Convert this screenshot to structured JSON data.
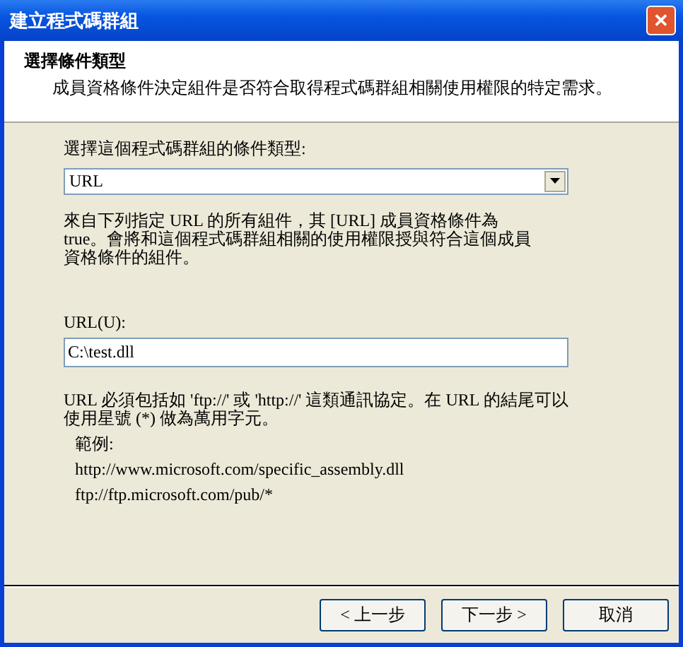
{
  "window": {
    "title": "建立程式碼群組",
    "close": "✕"
  },
  "header": {
    "title": "選擇條件類型",
    "description": "成員資格條件決定組件是否符合取得程式碼群組相關使用權限的特定需求。"
  },
  "condition_type": {
    "label": "選擇這個程式碼群組的條件類型:",
    "value": "URL"
  },
  "condition_description": "來自下列指定 URL 的所有組件，其 [URL] 成員資格條件為 true。會將和這個程式碼群組相關的使用權限授與符合這個成員資格條件的組件。",
  "url": {
    "label": "URL(U):",
    "value": "C:\\test.dll"
  },
  "help": "URL 必須包括如 'ftp://' 或 'http://' 這類通訊協定。在 URL 的結尾可以使用星號 (*) 做為萬用字元。",
  "examples": {
    "label": "範例:",
    "items": [
      "http://www.microsoft.com/specific_assembly.dll",
      "ftp://ftp.microsoft.com/pub/*"
    ]
  },
  "buttons": [
    {
      "label": "< 上一步"
    },
    {
      "label": "下一步 >"
    },
    {
      "label": "取消"
    }
  ]
}
